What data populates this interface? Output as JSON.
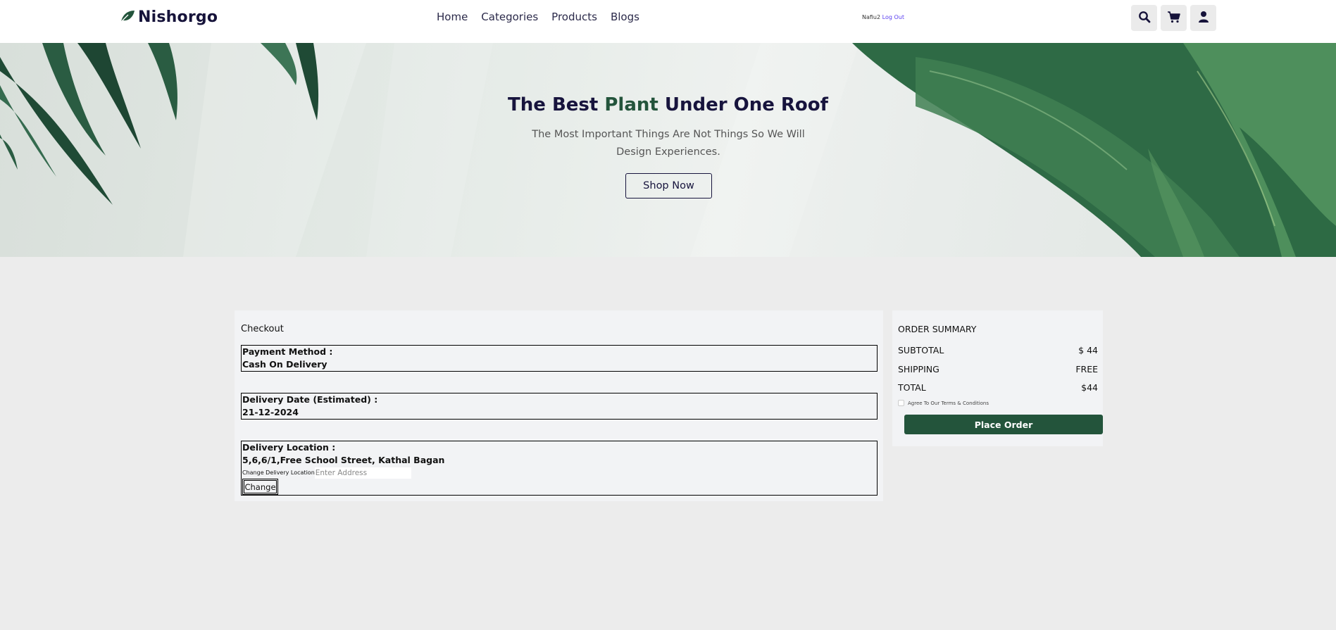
{
  "header": {
    "logo_text": "Nishorgo",
    "nav": [
      "Home",
      "Categories",
      "Products",
      "Blogs"
    ],
    "username": "Nafiu2",
    "logout_label": "Log Out",
    "icons": [
      "search-icon",
      "cart-icon",
      "user-icon"
    ]
  },
  "hero": {
    "title_part1": "The Best ",
    "title_accent": "Plant",
    "title_part2": " Under One Roof",
    "subtitle": "The Most Important Things Are Not Things So We Will Design Experiences.",
    "button_label": "Shop Now"
  },
  "checkout": {
    "title": "Checkout",
    "payment_label": "Payment Method :",
    "payment_value": "Cash On Delivery",
    "delivery_date_label": "Delivery Date (Estimated) :",
    "delivery_date_value": "21-12-2024",
    "location_label": "Delivery Location :",
    "location_value": "5,6,6/1,Free School Street, Kathal Bagan",
    "change_location_label": "Change Delivery Location",
    "address_placeholder": "Enter Address",
    "change_button": "Change"
  },
  "summary": {
    "title": "ORDER SUMMARY",
    "subtotal_label": "SUBTOTAL",
    "subtotal_value": "$ 44",
    "shipping_label": "SHIPPING",
    "shipping_value": "FREE",
    "total_label": "TOTAL",
    "total_value": "$44",
    "terms_label": "Agree To Our Terms & Conditions",
    "place_order_label": "Place Order"
  },
  "colors": {
    "brand_dark": "#17143d",
    "brand_green": "#23543b",
    "logout_link": "#5a3ff0",
    "page_bg": "#ececec"
  }
}
